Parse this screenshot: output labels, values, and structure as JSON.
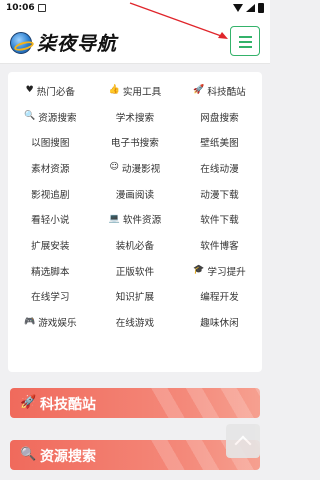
{
  "status_bar": {
    "time": "10:06"
  },
  "header": {
    "logo_text": "柒夜导航",
    "accent_color": "#34b26a"
  },
  "nav_grid": [
    [
      {
        "label": "热门必备",
        "icon": "heart-icon"
      },
      {
        "label": "实用工具",
        "icon": "thumbs-up-icon"
      },
      {
        "label": "科技酷站",
        "icon": "rocket-icon"
      }
    ],
    [
      {
        "label": "资源搜索",
        "icon": "search-icon"
      },
      {
        "label": "学术搜索"
      },
      {
        "label": "网盘搜索"
      }
    ],
    [
      {
        "label": "以图搜图"
      },
      {
        "label": "电子书搜索"
      },
      {
        "label": "壁纸美图"
      }
    ],
    [
      {
        "label": "素材资源"
      },
      {
        "label": "动漫影视",
        "icon": "smile-icon"
      },
      {
        "label": "在线动漫"
      }
    ],
    [
      {
        "label": "影视追剧"
      },
      {
        "label": "漫画阅读"
      },
      {
        "label": "动漫下载"
      }
    ],
    [
      {
        "label": "看轻小说"
      },
      {
        "label": "软件资源",
        "icon": "laptop-icon"
      },
      {
        "label": "软件下载"
      }
    ],
    [
      {
        "label": "扩展安装"
      },
      {
        "label": "装机必备"
      },
      {
        "label": "软件博客"
      }
    ],
    [
      {
        "label": "精选脚本"
      },
      {
        "label": "正版软件"
      },
      {
        "label": "学习提升",
        "icon": "graduation-cap-icon"
      }
    ],
    [
      {
        "label": "在线学习"
      },
      {
        "label": "知识扩展"
      },
      {
        "label": "编程开发"
      }
    ],
    [
      {
        "label": "游戏娱乐",
        "icon": "gamepad-icon"
      },
      {
        "label": "在线游戏"
      },
      {
        "label": "趣味休闲"
      }
    ]
  ],
  "sections": [
    {
      "title": "科技酷站",
      "icon": "rocket-icon"
    },
    {
      "title": "资源搜索",
      "icon": "search-icon"
    }
  ],
  "colors": {
    "section_gradient_start": "#f06a5c",
    "annotation_arrow": "#e0252b"
  }
}
